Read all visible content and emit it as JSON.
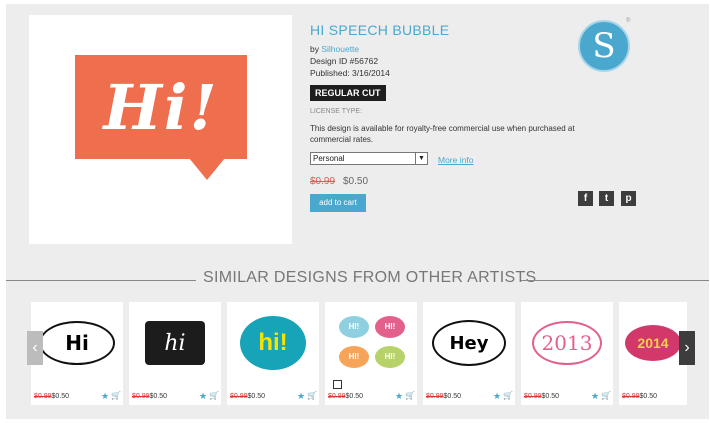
{
  "product": {
    "image_text": "Hi!",
    "title": "HI SPEECH BUBBLE",
    "by_prefix": "by ",
    "artist": "Silhouette",
    "design_id": "Design ID #56762",
    "published": "Published: 3/16/2014",
    "cut_type": "REGULAR CUT",
    "license_label": "LICENSE TYPE:",
    "license_desc": "This design is available for royalty-free commercial use when purchased at commercial rates.",
    "license_selected": "Personal",
    "more_info": "More info",
    "old_price": "$0.99",
    "new_price": "$0.50",
    "add_to_cart": "add to cart",
    "logo_letter": "S",
    "logo_reg": "®"
  },
  "social": {
    "facebook": "f",
    "twitter": "t",
    "pinterest": "p"
  },
  "similar": {
    "title": "SIMILAR DESIGNS FROM OTHER ARTISTS",
    "cards": [
      {
        "text": "Hi",
        "old": "$0.99",
        "new": "$0.50"
      },
      {
        "text": "hi",
        "old": "$0.99",
        "new": "$0.50"
      },
      {
        "text": "hi!",
        "old": "$0.99",
        "new": "$0.50"
      },
      {
        "text": "HI!",
        "old": "$0.99",
        "new": "$0.50"
      },
      {
        "text": "Hey",
        "old": "$0.99",
        "new": "$0.50"
      },
      {
        "text": "2013",
        "old": "$0.99",
        "new": "$0.50"
      },
      {
        "text": "2014",
        "old": "$0.99",
        "new": "$0.50"
      }
    ],
    "prev_arrow": "‹",
    "next_arrow": "›"
  },
  "colors": {
    "accent": "#4aa8cf",
    "brand_orange": "#ee6e4d",
    "sale_red": "#d33333"
  }
}
